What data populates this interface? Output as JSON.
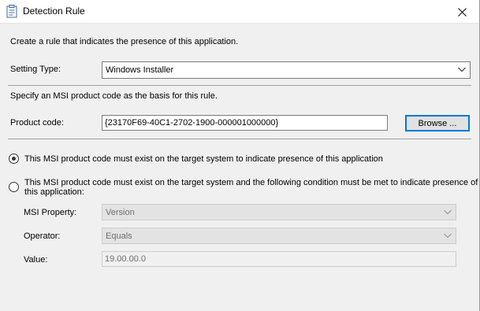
{
  "window": {
    "title": "Detection Rule"
  },
  "intro_text": "Create a rule that indicates the presence of this application.",
  "setting_type": {
    "label": "Setting Type:",
    "selected": "Windows Installer"
  },
  "msi_intro_text": "Specify an MSI product code as the basis for this rule.",
  "product_code": {
    "label": "Product code:",
    "value": "{23170F69-40C1-2702-1900-000001000000}",
    "browse_label": "Browse ..."
  },
  "options": {
    "exist": {
      "label": "This MSI product code must exist on the target system to indicate presence of this application",
      "selected": true
    },
    "condition": {
      "label_line1": "This MSI product code must exist on the target system and the following condition must be met to indicate presence of",
      "label_line2": "this application:",
      "selected": false
    }
  },
  "condition": {
    "msi_property_label": "MSI Property:",
    "msi_property_value": "Version",
    "operator_label": "Operator:",
    "operator_value": "Equals",
    "value_label": "Value:",
    "value_value": "19.00.00.0"
  },
  "colors": {
    "accent": "#0078d7",
    "dialog_bg": "#f0f0f0",
    "disabled_text": "#6d6d6d"
  }
}
